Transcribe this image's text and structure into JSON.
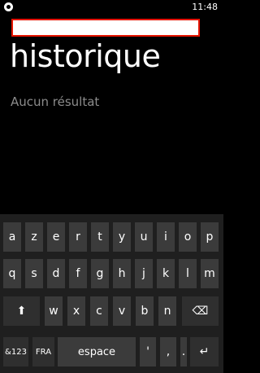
{
  "status": {
    "time": "11:48",
    "icon": "ring-status-icon"
  },
  "search": {
    "value": "",
    "placeholder": ""
  },
  "page": {
    "title": "historique",
    "empty_message": "Aucun résultat"
  },
  "keyboard": {
    "row1": [
      "a",
      "z",
      "e",
      "r",
      "t",
      "y",
      "u",
      "i",
      "o",
      "p"
    ],
    "row2": [
      "q",
      "s",
      "d",
      "f",
      "g",
      "h",
      "j",
      "k",
      "l",
      "m"
    ],
    "row3": {
      "shift": "⬆",
      "letters": [
        "w",
        "x",
        "c",
        "v",
        "b",
        "n"
      ],
      "backspace": "⌫"
    },
    "row4": {
      "symbols": "&123",
      "language": "FRA",
      "space": "espace",
      "apostrophe": "'",
      "comma": ",",
      "period": ".",
      "enter": "↵"
    }
  }
}
